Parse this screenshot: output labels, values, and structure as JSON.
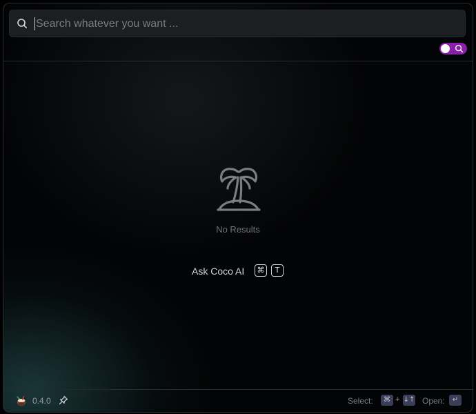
{
  "search": {
    "placeholder": "Search whatever you want ...",
    "value": ""
  },
  "mode_toggle": {
    "state": "on",
    "accent": "#8a20a8",
    "icon": "search-icon"
  },
  "empty_state": {
    "icon": "palm-island-icon",
    "message": "No Results"
  },
  "ask_ai": {
    "label": "Ask Coco AI",
    "shortcut": [
      "⌘",
      "T"
    ]
  },
  "footer": {
    "app_icon": "coco-logo",
    "version": "0.4.0",
    "pin_icon": "pin-icon",
    "select_label": "Select:",
    "select_key_modifier": "⌘",
    "select_plus": "+",
    "select_key_arrows": "↓↑",
    "open_label": "Open:",
    "open_key": "↵"
  }
}
